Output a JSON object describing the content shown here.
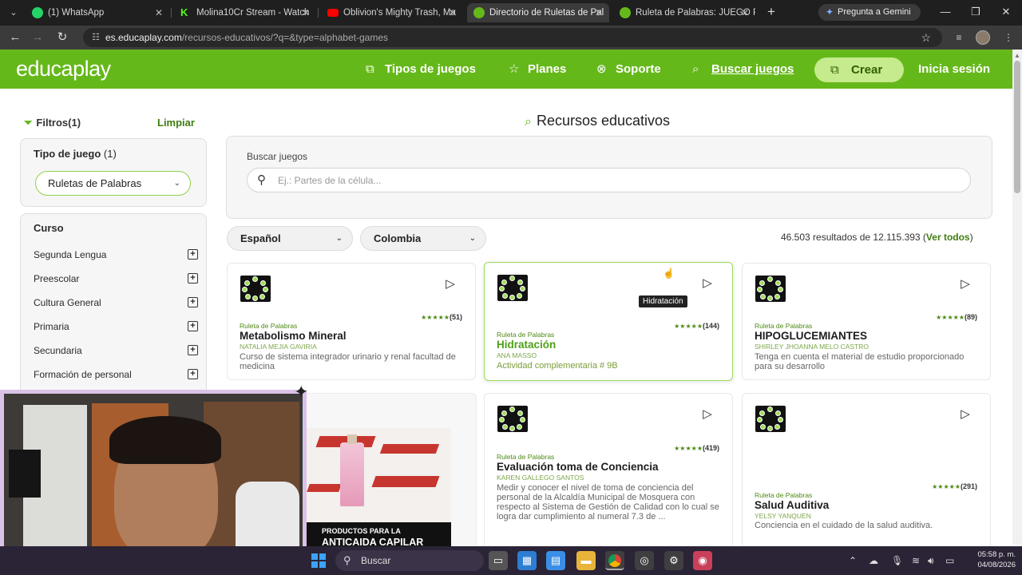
{
  "browser": {
    "tabs": [
      {
        "title": "(1) WhatsApp",
        "favicon_color": "#25d366",
        "active": false
      },
      {
        "title": "Molina10Cr Stream - Watch",
        "favicon_color": "#53fc18",
        "active": false
      },
      {
        "title": "Oblivion's Mighty Trash, Ma",
        "favicon_color": "#ff0000",
        "active": false
      },
      {
        "title": "Directorio de Ruletas de Pal",
        "favicon_color": "#65b81a",
        "active": true
      },
      {
        "title": "Ruleta de Palabras: JUEGO P",
        "favicon_color": "#65b81a",
        "active": false
      }
    ],
    "gemini_label": "Pregunta a Gemini",
    "url_host": "es.educaplay.com",
    "url_path": "/recursos-educativos/?q=&type=alphabet-games"
  },
  "header": {
    "logo": "educaplay",
    "nav": [
      {
        "label": "Tipos de juegos",
        "icon": "shapes-icon"
      },
      {
        "label": "Planes",
        "icon": "star-icon"
      },
      {
        "label": "Soporte",
        "icon": "lifebuoy-icon"
      },
      {
        "label": "Buscar juegos",
        "icon": "search-shapes-icon"
      }
    ],
    "create_label": "Crear",
    "login_label": "Inicia sesión"
  },
  "sidebar": {
    "filters_label": "Filtros(1)",
    "clear_label": "Limpiar",
    "game_type_title": "Tipo de juego",
    "game_type_count": "(1)",
    "game_type_selected": "Ruletas de Palabras",
    "course_title": "Curso",
    "courses": [
      "Segunda Lengua",
      "Preescolar",
      "Cultura General",
      "Primaria",
      "Secundaria",
      "Formación de personal"
    ]
  },
  "main": {
    "title": "Recursos educativos",
    "search_label": "Buscar juegos",
    "search_placeholder": "Ej.: Partes de la célula...",
    "language": "Español",
    "country": "Colombia",
    "results_prefix": "46.503 resultados de 12.115.393 (",
    "results_link": "Ver todos",
    "results_suffix": ")",
    "tooltip": "Hidratación",
    "cards": [
      {
        "type": "Ruleta de Palabras",
        "title": "Metabolismo Mineral",
        "author": "NATALIA MEJIA GAVIRIA",
        "desc": "Curso de sistema integrador urinario y renal facultad de medicina",
        "rating": "★★★★★",
        "count": "(51)"
      },
      {
        "type": "Ruleta de Palabras",
        "title": "Hidratación",
        "author": "ANA MASSO",
        "desc": "Actividad complementaria # 9B",
        "rating": "★★★★★",
        "count": "(144)"
      },
      {
        "type": "Ruleta de Palabras",
        "title": "HIPOGLUCEMIANTES",
        "author": "SHIRLEY JHOANNA MELO CASTRO",
        "desc": "Tenga en cuenta el material de estudio proporcionado para su desarrollo",
        "rating": "★★★★★",
        "count": "(89)"
      },
      {
        "type": "Ruleta de Palabras",
        "title": "Evaluación toma de Conciencia",
        "author": "KAREN GALLEGO SANTOS",
        "desc": "Medir y conocer el nivel de toma de conciencia del personal de la Alcaldía Municipal de Mosquera con respecto al Sistema de Gestión de Calidad con lo cual se logra dar cumplimiento al numeral 7.3 de ...",
        "rating": "★★★★★",
        "count": "(419)"
      },
      {
        "type": "Ruleta de Palabras",
        "title": "Salud Auditiva",
        "author": "YELSY YANQUEN",
        "desc": "Conciencia en el cuidado de la salud auditiva.",
        "rating": "★★★★★",
        "count": "(291)"
      }
    ],
    "ad": {
      "line1": "PRODUCTOS PARA LA",
      "line2": "ANTICAIDA CAPILAR"
    }
  },
  "taskbar": {
    "search_label": "Buscar",
    "time": "05:58 p. m.",
    "date": "04/08/2026"
  }
}
